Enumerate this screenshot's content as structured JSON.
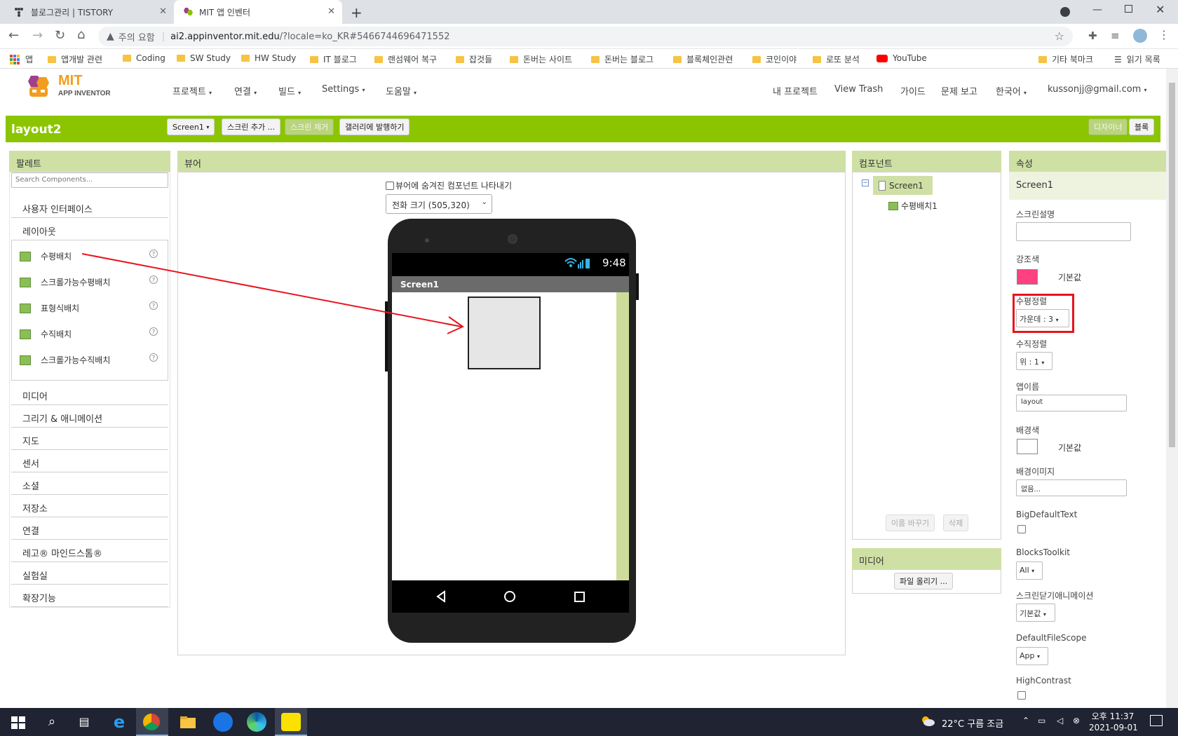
{
  "browser": {
    "tabs": [
      {
        "title": "블로그관리 | TISTORY"
      },
      {
        "title": "MIT 앱 인벤터"
      }
    ],
    "security_label": "주의 요함",
    "url_host": "ai2.appinventor.mit.edu",
    "url_path": "/?locale=ko_KR#5466744696471552",
    "bookmarks": [
      "앱",
      "앱개발 관련",
      "Coding",
      "SW Study",
      "HW Study",
      "IT 블로그",
      "랜섬웨어 복구",
      "잡것들",
      "돈버는 사이트",
      "돈버는 블로그",
      "블록체인관련",
      "코인이야",
      "로또 분석",
      "YouTube"
    ],
    "bookmarks_right": [
      "기타 북마크",
      "읽기 목록"
    ]
  },
  "app": {
    "logo_mit": "MIT",
    "logo_sub": "APP INVENTOR",
    "menus": [
      "프로젝트",
      "연결",
      "빌드",
      "Settings",
      "도움말"
    ],
    "right_menus": [
      "내 프로젝트",
      "View Trash",
      "가이드",
      "문제 보고",
      "한국어",
      "kussonjj@gmail.com"
    ],
    "project_name": "layout2",
    "screen_dropdown": "Screen1",
    "add_screen": "스크린 추가 ...",
    "remove_screen": "스크린 제거",
    "publish_gallery": "갤러리에 발행하기",
    "designer_btn": "디자이너",
    "blocks_btn": "블록"
  },
  "palette": {
    "title": "팔레트",
    "search_placeholder": "Search Components...",
    "cat_ui": "사용자 인터페이스",
    "cat_layout": "레이아웃",
    "layout_items": [
      "수평배치",
      "스크롤가능수평배치",
      "표형식배치",
      "수직배치",
      "스크롤가능수직배치"
    ],
    "categories": [
      "미디어",
      "그리기 & 애니메이션",
      "지도",
      "센서",
      "소셜",
      "저장소",
      "연결",
      "레고® 마인드스톰®",
      "실험실",
      "확장기능"
    ]
  },
  "viewer": {
    "title": "뷰어",
    "show_hidden": "뷰어에 숨겨진 컴포넌트 나타내기",
    "phone_size": "전화 크기 (505,320)",
    "status_time": "9:48",
    "screen_title": "Screen1"
  },
  "components": {
    "title": "컴포넌트",
    "tree_root": "Screen1",
    "tree_child": "수평배치1",
    "rename": "이름 바꾸기",
    "delete": "삭제",
    "media_title": "미디어",
    "upload": "파일 올리기 ..."
  },
  "properties": {
    "title": "속성",
    "component": "Screen1",
    "labels": {
      "about": "스크린설명",
      "accent": "강조색",
      "halign": "수평정렬",
      "valign": "수직정렬",
      "appname": "앱이름",
      "bgcolor": "배경색",
      "bgimage": "배경이미지",
      "bigtext": "BigDefaultText",
      "blocks": "BlocksToolkit",
      "closeanim": "스크린닫기애니메이션",
      "filescope": "DefaultFileScope",
      "contrast": "HighContrast"
    },
    "accent_value": "기본값",
    "accent_color": "#ff4081",
    "halign_value": "가운데 : 3",
    "valign_value": "위 : 1",
    "appname_value": "layout",
    "bg_value": "기본값",
    "bgimage_value": "없음...",
    "blocks_value": "All",
    "closeanim_value": "기본값",
    "filescope_value": "App"
  },
  "taskbar": {
    "weather": "22°C  구름 조금",
    "time": "오후 11:37",
    "date": "2021-09-01"
  },
  "colors": {
    "app_green": "#8bc500",
    "panel_header": "#cfe0a4",
    "highlight_red": "#e8141e"
  }
}
